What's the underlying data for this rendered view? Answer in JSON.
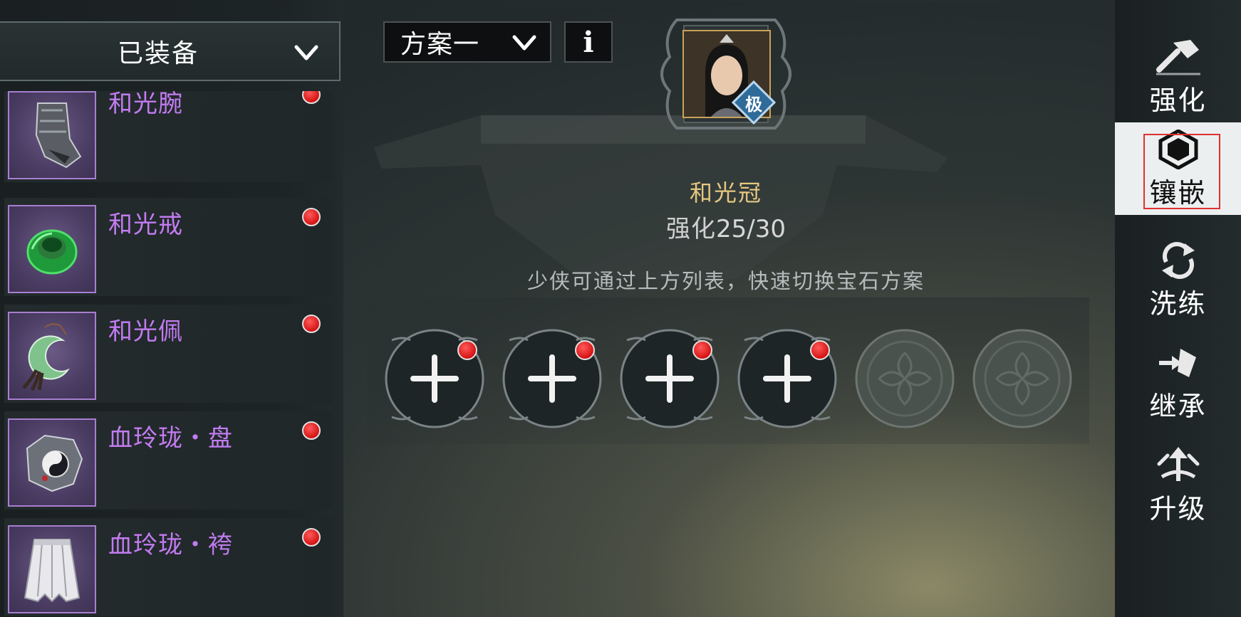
{
  "left_panel": {
    "dropdown": {
      "label": "已装备"
    },
    "items": [
      {
        "name": "和光腕",
        "icon": "bracer-icon",
        "has_alert": true
      },
      {
        "name": "和光戒",
        "icon": "jade-ring-icon",
        "has_alert": true
      },
      {
        "name": "和光佩",
        "icon": "jade-pendant-icon",
        "has_alert": true
      },
      {
        "name": "血玲珑・盘",
        "icon": "yin-yang-belt-icon",
        "has_alert": true
      },
      {
        "name": "血玲珑・袴",
        "icon": "pleated-skirt-icon",
        "has_alert": true
      }
    ]
  },
  "top_controls": {
    "plan_select": {
      "label": "方案一"
    },
    "info_button": {
      "label": "i"
    }
  },
  "character": {
    "grade_badge": "极"
  },
  "equipment": {
    "name": "和光冠",
    "strength_label": "强化",
    "strength_value": "25/30",
    "hint": "少侠可通过上方列表，快速切换宝石方案"
  },
  "gem_sockets": [
    {
      "state": "empty",
      "icon": "plus-icon",
      "has_alert": true
    },
    {
      "state": "empty",
      "icon": "plus-icon",
      "has_alert": true
    },
    {
      "state": "empty",
      "icon": "plus-icon",
      "has_alert": true
    },
    {
      "state": "empty",
      "icon": "plus-icon",
      "has_alert": true
    },
    {
      "state": "locked",
      "icon": "lock-emblem-icon",
      "has_alert": false
    },
    {
      "state": "locked",
      "icon": "lock-emblem-icon",
      "has_alert": false
    }
  ],
  "right_tabs": [
    {
      "label": "强化",
      "icon": "hammer-icon",
      "active": false
    },
    {
      "label": "镶嵌",
      "icon": "gem-icon",
      "active": true
    },
    {
      "label": "洗练",
      "icon": "refresh-icon",
      "active": false
    },
    {
      "label": "继承",
      "icon": "inherit-icon",
      "active": false
    },
    {
      "label": "升级",
      "icon": "upgrade-icon",
      "active": false
    }
  ],
  "colors": {
    "item_name": "#c27bf0",
    "equipment_name": "#e6c880",
    "alert_dot": "#d51313",
    "active_tab_bg": "#ecefef",
    "highlight_border": "#e13030"
  }
}
